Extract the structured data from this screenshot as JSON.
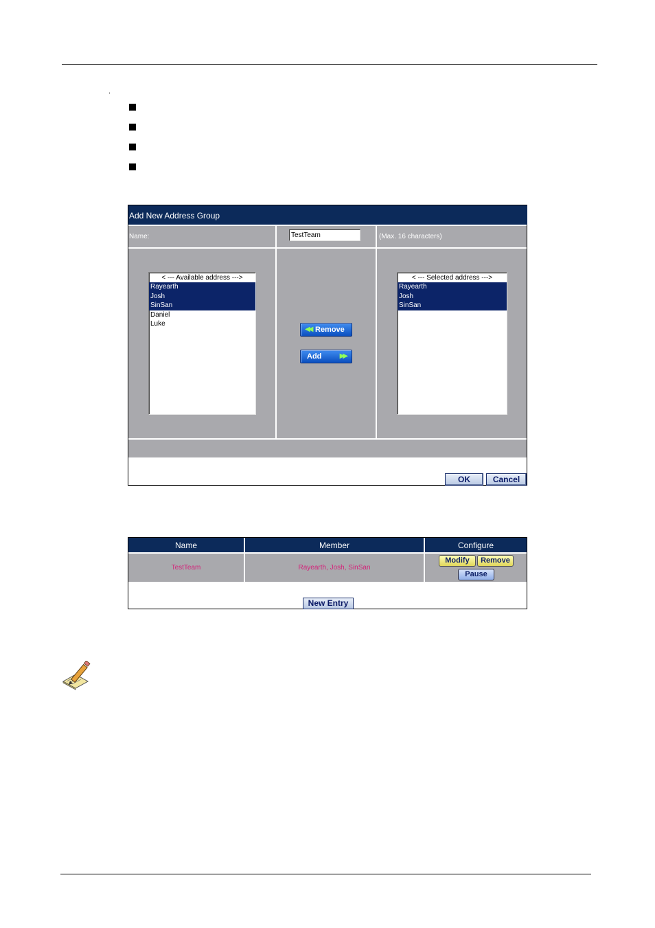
{
  "doc": {
    "lead_char": "."
  },
  "dialog": {
    "title": "Add New Address Group",
    "name_label": "Name:",
    "name_value": "TestTeam",
    "name_hint": "(Max. 16 characters)",
    "available": {
      "header": "< --- Available address --->",
      "items": [
        {
          "label": "Rayearth",
          "selected": true
        },
        {
          "label": "Josh",
          "selected": true
        },
        {
          "label": "SinSan",
          "selected": true
        },
        {
          "label": "Daniel",
          "selected": false
        },
        {
          "label": "Luke",
          "selected": false
        }
      ]
    },
    "selected": {
      "header": "< --- Selected address --->",
      "items": [
        {
          "label": "Rayearth",
          "selected": true
        },
        {
          "label": "Josh",
          "selected": true
        },
        {
          "label": "SinSan",
          "selected": true
        }
      ]
    },
    "remove_label": "Remove",
    "add_label": "Add",
    "ok_label": "OK",
    "cancel_label": "Cancel"
  },
  "groups_table": {
    "columns": [
      "Name",
      "Member",
      "Configure"
    ],
    "rows": [
      {
        "name": "TestTeam",
        "member": "Rayearth, Josh, SinSan"
      }
    ],
    "modify_label": "Modify",
    "remove_label": "Remove",
    "pause_label": "Pause",
    "new_entry_label": "New Entry"
  },
  "icons": {
    "bullet": "square-bullet-icon",
    "note": "pencil-note-icon",
    "double_left": "double-chevron-left-icon",
    "double_right": "double-chevron-right-icon"
  },
  "colors": {
    "header_bg": "#0c2a5a",
    "cell_bg": "#a9a9ad",
    "selection": "#0c2468",
    "table_text": "#d4237a"
  }
}
